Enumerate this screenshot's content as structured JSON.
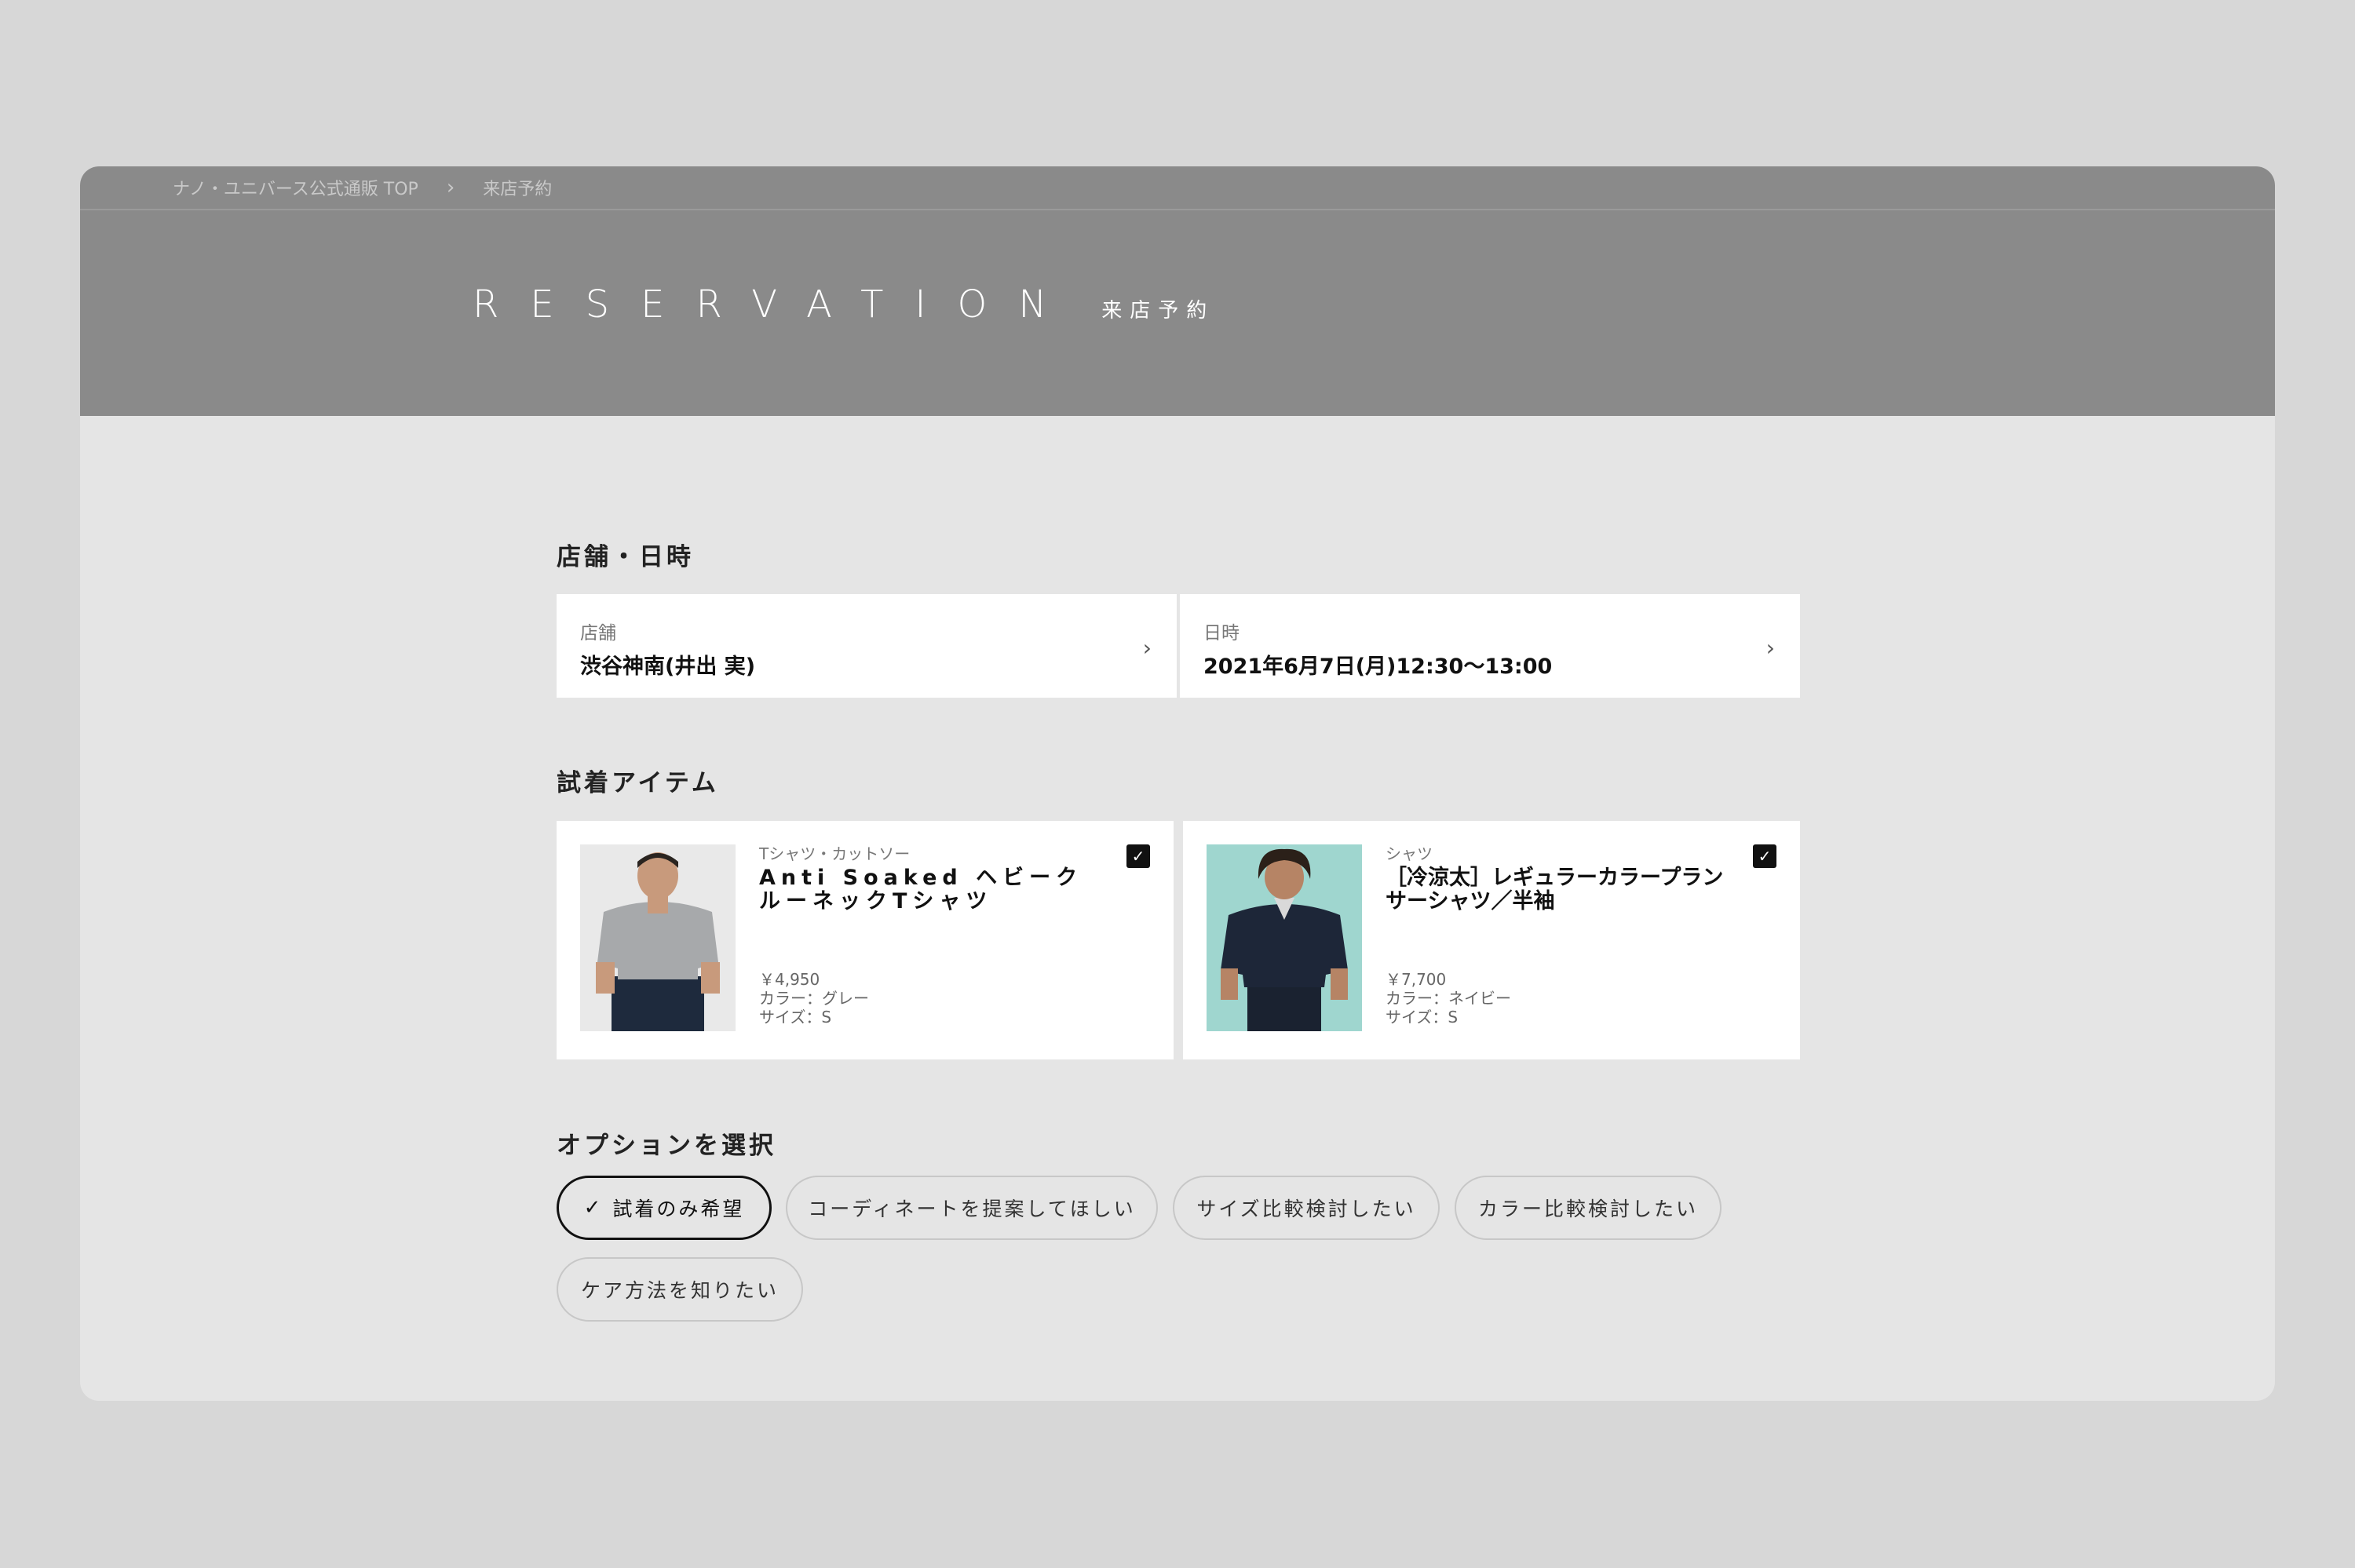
{
  "breadcrumb": {
    "items": [
      "ナノ・ユニバース公式通販 TOP",
      "来店予約"
    ]
  },
  "hero": {
    "title_en": "RESERVATION",
    "title_ja": "来店予約"
  },
  "store_section": {
    "title": "店舗・日時",
    "store": {
      "label": "店舗",
      "value": "渋谷神南(井出 実)"
    },
    "datetime": {
      "label": "日時",
      "value": "2021年6月7日(月)12:30〜13:00"
    }
  },
  "items_section": {
    "title": "試着アイテム",
    "items": [
      {
        "category": "Tシャツ・カットソー",
        "name": "Anti Soaked ヘビークルーネックTシャツ",
        "price": "￥4,950",
        "color": "カラー：グレー",
        "size": "サイズ：S",
        "checked": true
      },
      {
        "category": "シャツ",
        "name": "［冷涼太］レギュラーカラープランサーシャツ／半袖",
        "price": "￥7,700",
        "color": "カラー：ネイビー",
        "size": "サイズ：S",
        "checked": true
      }
    ]
  },
  "options_section": {
    "title": "オプションを選択",
    "options": [
      {
        "label": "試着のみ希望",
        "selected": true
      },
      {
        "label": "コーディネートを提案してほしい",
        "selected": false
      },
      {
        "label": "サイズ比較検討したい",
        "selected": false
      },
      {
        "label": "カラー比較検討したい",
        "selected": false
      },
      {
        "label": "ケア方法を知りたい",
        "selected": false
      }
    ]
  },
  "colors": {
    "page_bg": "#d7d7d7",
    "hero_bg": "#8a8a8a",
    "content_bg": "#e5e5e5",
    "card_bg": "#ffffff",
    "accent": "#111111"
  }
}
